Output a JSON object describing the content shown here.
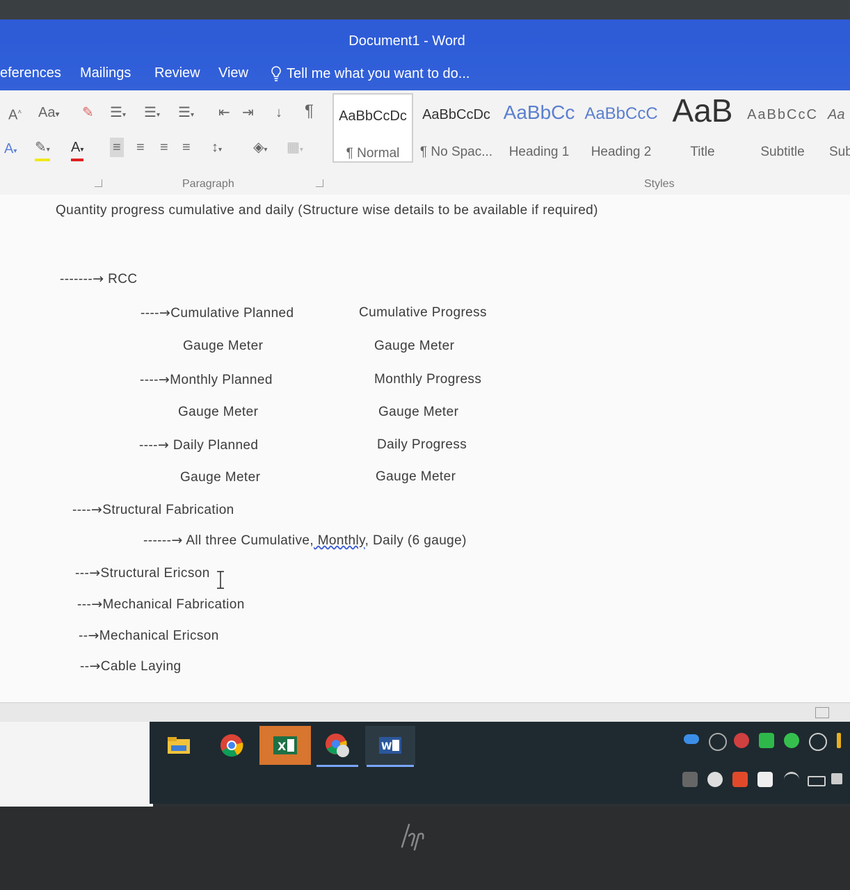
{
  "window": {
    "title": "Document1 - Word"
  },
  "tabs": [
    "eferences",
    "Mailings",
    "Review",
    "View"
  ],
  "tell_me": "Tell me what you want to do...",
  "ribbon": {
    "font_size_label": "Aa",
    "paragraph_label": "Paragraph",
    "styles_label": "Styles",
    "styles": [
      {
        "preview": "AaBbCcDc",
        "name": "¶ Normal",
        "selected": true
      },
      {
        "preview": "AaBbCcDc",
        "name": "¶ No Spac..."
      },
      {
        "preview": "AaBbCc",
        "name": "Heading 1"
      },
      {
        "preview": "AaBbCcC",
        "name": "Heading 2"
      },
      {
        "preview": "AaB",
        "name": "Title"
      },
      {
        "preview": "AaBbCcC",
        "name": "Subtitle"
      },
      {
        "preview": "Aa",
        "name": "Sub"
      }
    ]
  },
  "document": {
    "heading": "Quantity progress cumulative and daily (Structure wise details to be available if required)",
    "lines": {
      "rcc_dashes": "-------",
      "rcc": " RCC",
      "cum_planned_dashes": "----",
      "cum_planned": "Cumulative Planned",
      "cum_progress": "Cumulative Progress",
      "gauge1_left": "Gauge Meter",
      "gauge1_right": "Gauge Meter",
      "mon_planned_dashes": "----",
      "mon_planned": "Monthly Planned",
      "mon_progress": "Monthly Progress",
      "gauge2_left": "Gauge Meter",
      "gauge2_right": "Gauge Meter",
      "daily_planned_dashes": "----",
      "daily_planned": " Daily Planned",
      "daily_progress": "Daily Progress",
      "gauge3_left": "Gauge Meter",
      "gauge3_right": "Gauge Meter",
      "struct_fab_dashes": "----",
      "struct_fab": "Structural Fabrication",
      "all_three_dashes": "------",
      "all_three_a": " All three Cumulative,",
      "all_three_b": " Monthly",
      "all_three_c": ", Daily (6 gauge)",
      "struct_eric_dashes": "---",
      "struct_eric": "Structural Ericson",
      "mech_fab_dashes": "---",
      "mech_fab": "Mechanical Fabrication",
      "mech_eric_dashes": "--",
      "mech_eric": "Mechanical Ericson",
      "cable_dashes": "--",
      "cable": "Cable Laying"
    }
  },
  "taskbar": {
    "apps": [
      "file-explorer",
      "chrome",
      "excel",
      "chrome-profile",
      "word"
    ]
  },
  "colors": {
    "titlebar": "#2e5bd6",
    "ribbon": "#f3f3f3",
    "document_text": "#3c3c3c",
    "taskbar": "#1e2a30",
    "excel_active": "#d8752e"
  }
}
